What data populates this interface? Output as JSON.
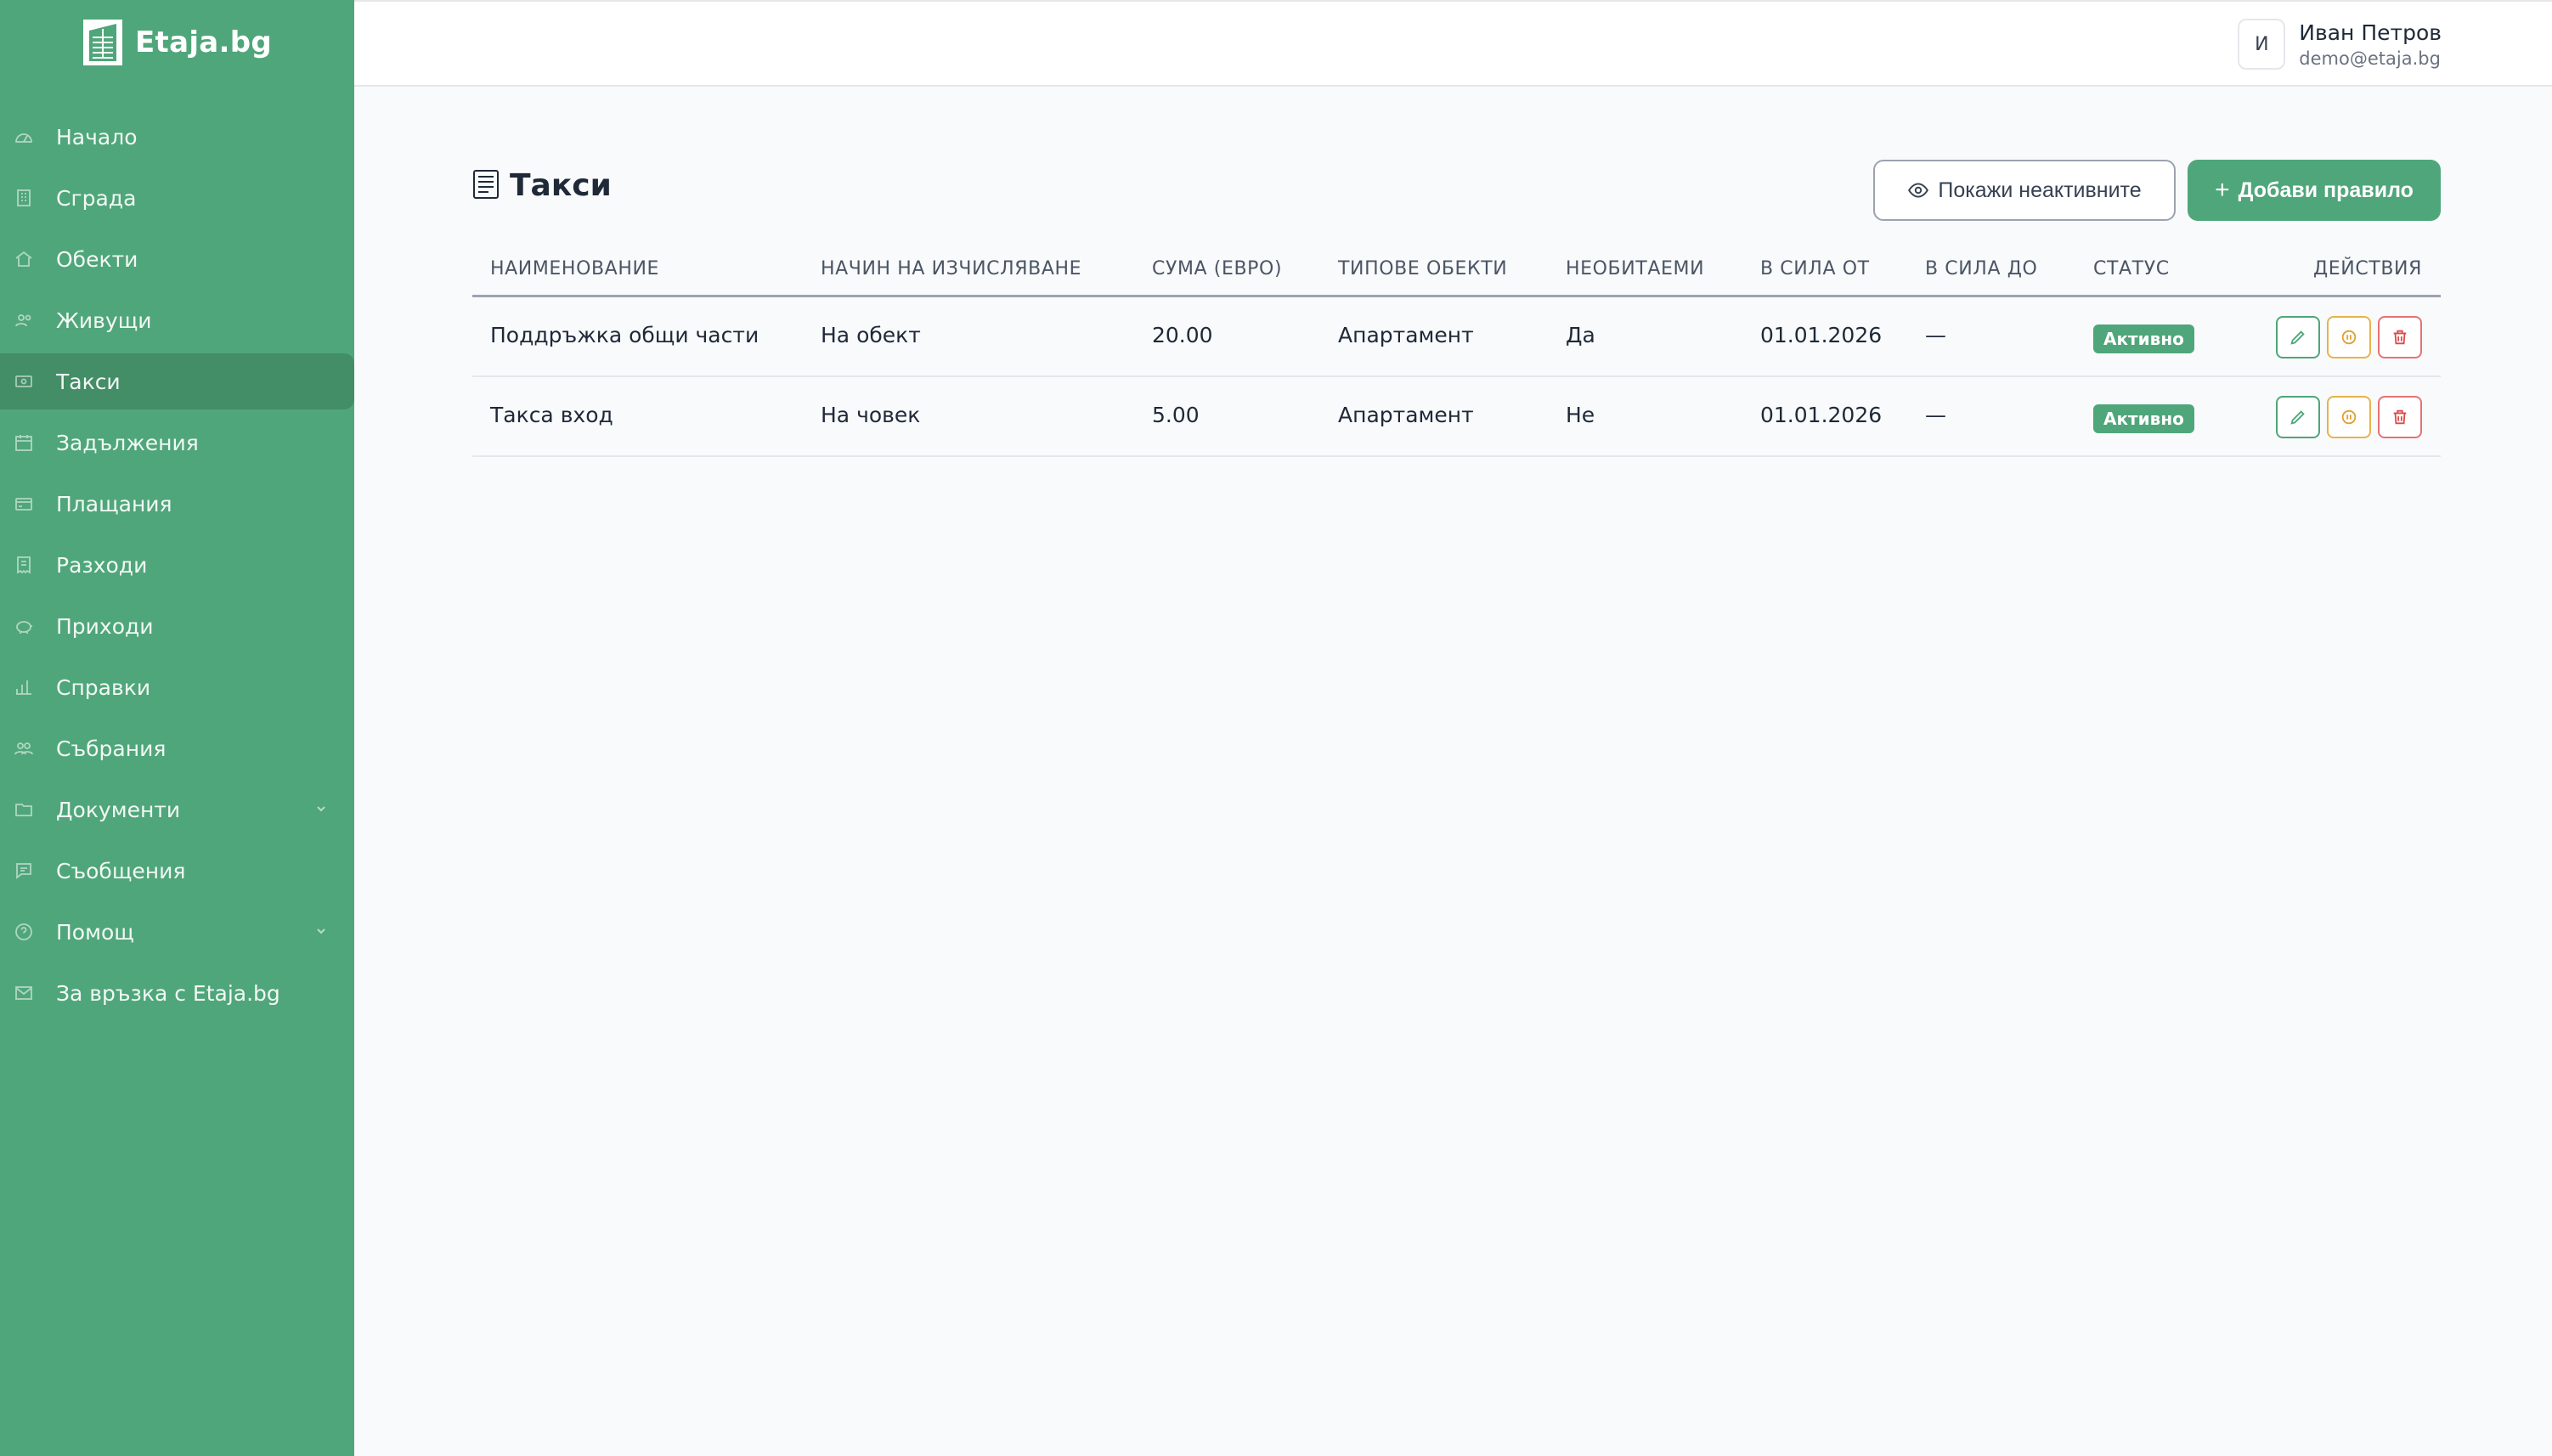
{
  "brand": {
    "name": "Etaja.bg"
  },
  "sidebar": {
    "items": [
      {
        "label": "Начало",
        "icon": "dashboard-icon"
      },
      {
        "label": "Сграда",
        "icon": "building-icon"
      },
      {
        "label": "Обекти",
        "icon": "home-icon"
      },
      {
        "label": "Живущи",
        "icon": "users-icon"
      },
      {
        "label": "Такси",
        "icon": "fees-icon",
        "active": true
      },
      {
        "label": "Задължения",
        "icon": "calendar-icon"
      },
      {
        "label": "Плащания",
        "icon": "credit-card-icon"
      },
      {
        "label": "Разходи",
        "icon": "receipt-icon"
      },
      {
        "label": "Приходи",
        "icon": "piggy-bank-icon"
      },
      {
        "label": "Справки",
        "icon": "bar-chart-icon"
      },
      {
        "label": "Събрания",
        "icon": "group-icon"
      },
      {
        "label": "Документи",
        "icon": "folder-icon",
        "chevron": true
      },
      {
        "label": "Съобщения",
        "icon": "message-icon"
      },
      {
        "label": "Помощ",
        "icon": "help-icon",
        "chevron": true
      },
      {
        "label": "За връзка с Etaja.bg",
        "icon": "mail-icon"
      }
    ]
  },
  "header": {
    "user": {
      "initial": "И",
      "name": "Иван Петров",
      "email": "demo@etaja.bg"
    }
  },
  "main": {
    "title": "Такси",
    "show_inactive_label": "Покажи неактивните",
    "add_rule_label": "Добави правило",
    "table": {
      "columns": [
        "Наименование",
        "Начин на изчисляване",
        "Сума (евро)",
        "Типове обекти",
        "Необитаеми",
        "В сила от",
        "В сила до",
        "Статус",
        "Действия"
      ],
      "rows": [
        {
          "name": "Поддръжка общи части",
          "method": "На обект",
          "amount": "20.00",
          "types": "Апартамент",
          "uninhabited": "Да",
          "from": "01.01.2026",
          "to": "—",
          "status": "Активно"
        },
        {
          "name": "Такса вход",
          "method": "На човек",
          "amount": "5.00",
          "types": "Апартамент",
          "uninhabited": "Не",
          "from": "01.01.2026",
          "to": "—",
          "status": "Активно"
        }
      ]
    }
  },
  "colors": {
    "primary": "#4fa67a",
    "warning": "#e0a030",
    "danger": "#dc4a4a"
  }
}
